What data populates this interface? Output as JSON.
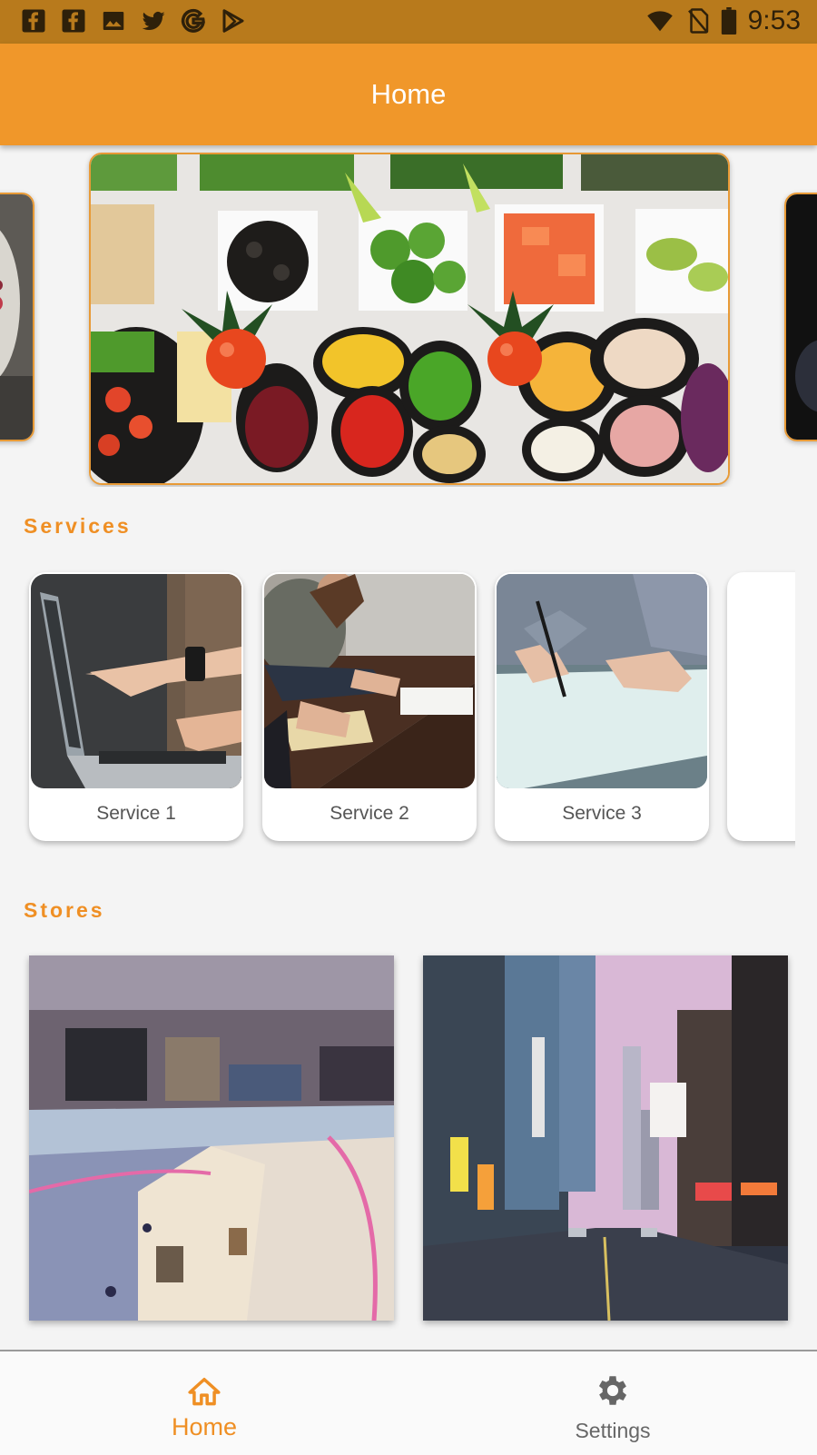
{
  "status_bar": {
    "time": "9:53",
    "left_icons": [
      "facebook-icon",
      "facebook-icon",
      "image-icon",
      "twitter-icon",
      "google-icon",
      "play-store-icon"
    ],
    "right_icons": [
      "wifi-icon",
      "no-sim-icon",
      "battery-icon"
    ]
  },
  "app_bar": {
    "title": "Home"
  },
  "carousel": {
    "slides": [
      "salad-plate-image",
      "salad-bar-image",
      "dark-image"
    ]
  },
  "sections": {
    "services": "Services",
    "stores": "Stores"
  },
  "services": [
    {
      "label": "Service 1",
      "image": "laptop-pointing-image"
    },
    {
      "label": "Service 2",
      "image": "meeting-table-image"
    },
    {
      "label": "Service 3",
      "image": "signing-document-image"
    },
    {
      "label": "S",
      "image": ""
    }
  ],
  "stores": [
    {
      "image": "shopping-mall-image"
    },
    {
      "image": "city-street-image"
    }
  ],
  "bottom_nav": {
    "items": [
      {
        "label": "Home",
        "icon": "home-icon",
        "active": true
      },
      {
        "label": "Settings",
        "icon": "gear-icon",
        "active": false
      }
    ]
  },
  "colors": {
    "primary": "#f0972a",
    "status_bar": "#b87a1c",
    "accent_text": "#ef8f24",
    "background": "#f4f4f4"
  }
}
